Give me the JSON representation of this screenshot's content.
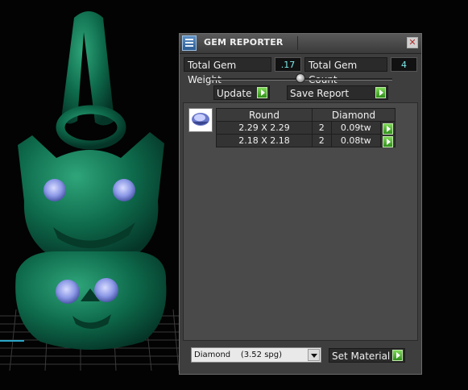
{
  "window": {
    "title": "GEM REPORTER",
    "close_glyph": "✕"
  },
  "summary": {
    "weight_label": "Total Gem Weight",
    "weight_value": ".17",
    "count_label": "Total Gem Count",
    "count_value": "4"
  },
  "actions": {
    "update_label": "Update",
    "save_report_label": "Save Report"
  },
  "table": {
    "headers": [
      "Round",
      "Diamond"
    ],
    "rows": [
      {
        "size": "2.29 X 2.29",
        "qty": "2",
        "weight": "0.09tw"
      },
      {
        "size": "2.18 X 2.18",
        "qty": "2",
        "weight": "0.08tw"
      }
    ]
  },
  "material": {
    "selected": "Diamond    (3.52 spg)",
    "set_label": "Set Material"
  },
  "colors": {
    "model_green": "#0e6b4c",
    "gem_blue": "#9aa8e8",
    "go_green": "#4cbf2a",
    "value_cyan": "#7ee8e8"
  },
  "icons": [
    "gem-reporter-icon",
    "close-icon",
    "gem-round-icon",
    "arrow-right-icon",
    "dropdown-arrow-icon"
  ]
}
